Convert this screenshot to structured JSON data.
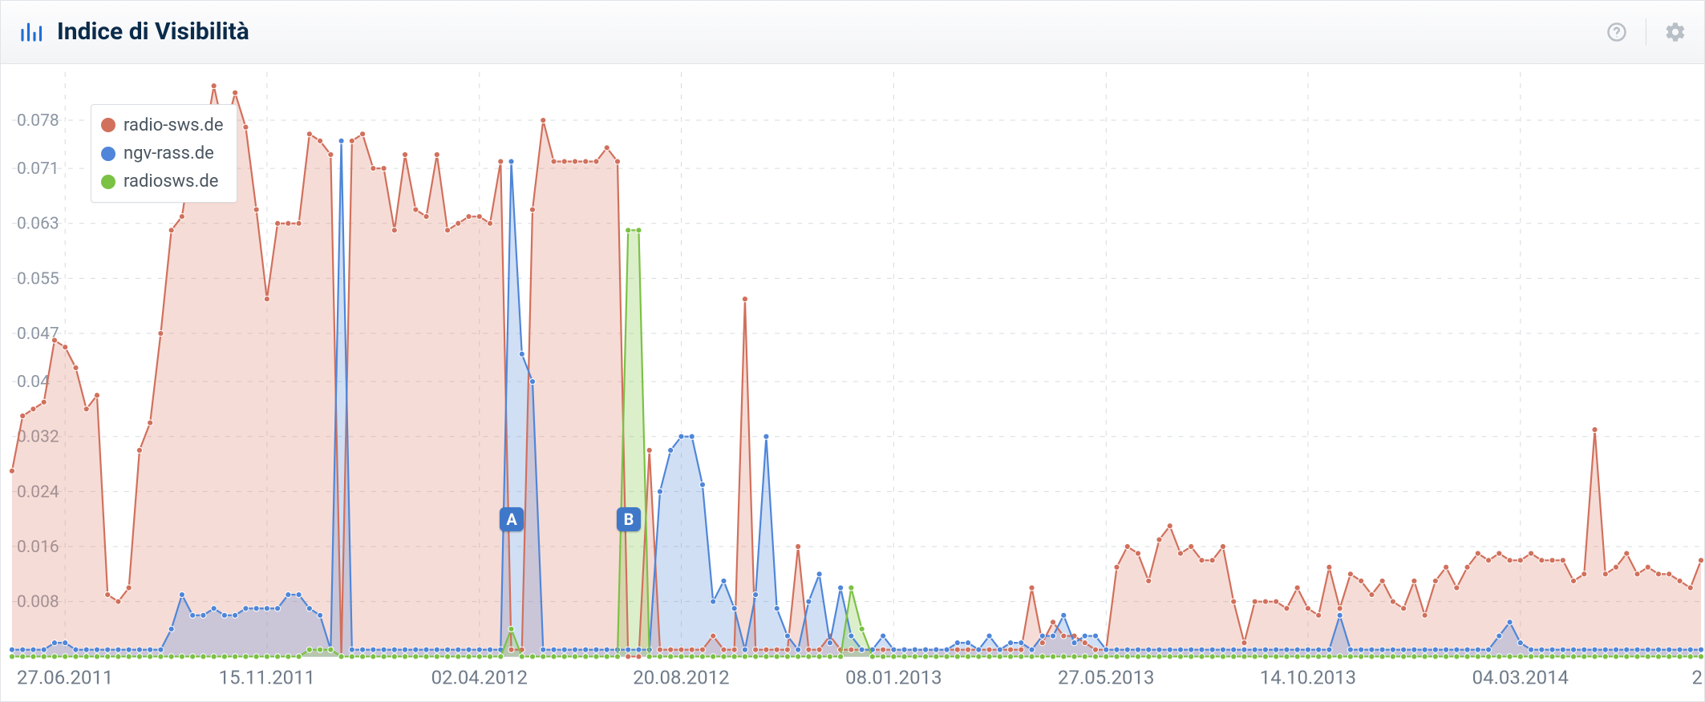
{
  "header": {
    "title": "Indice di Visibilità"
  },
  "legend": [
    {
      "label": "radio-sws.de",
      "color": "#d1705c"
    },
    {
      "label": "ngv-rass.de",
      "color": "#4f86d9"
    },
    {
      "label": "radiosws.de",
      "color": "#7bc144"
    }
  ],
  "annotations": [
    {
      "id": "A",
      "xindex": 47,
      "color": "#3f78c9"
    },
    {
      "id": "B",
      "xindex": 58,
      "color": "#3f78c9"
    }
  ],
  "chart_data": {
    "type": "area",
    "title": "Indice di Visibilità",
    "xlabel": "",
    "ylabel": "",
    "ylim": [
      0,
      0.085
    ],
    "y_ticks": [
      0.008,
      0.016,
      0.024,
      0.032,
      0.04,
      0.047,
      0.055,
      0.063,
      0.071,
      0.078
    ],
    "x_tick_labels": [
      "27.06.2011",
      "15.11.2011",
      "02.04.2012",
      "20.08.2012",
      "08.01.2013",
      "27.05.2013",
      "14.10.2013",
      "04.03.2014"
    ],
    "x_tick_indices": [
      5,
      24,
      44,
      63,
      83,
      103,
      122,
      142
    ],
    "n_points": 160,
    "series": [
      {
        "name": "radio-sws.de",
        "color": "#d1705c",
        "fill": "rgba(221,128,106,0.28)",
        "values": [
          0.027,
          0.035,
          0.036,
          0.037,
          0.046,
          0.045,
          0.042,
          0.036,
          0.038,
          0.009,
          0.008,
          0.01,
          0.03,
          0.034,
          0.047,
          0.062,
          0.064,
          0.074,
          0.074,
          0.083,
          0.076,
          0.082,
          0.077,
          0.065,
          0.052,
          0.063,
          0.063,
          0.063,
          0.076,
          0.075,
          0.073,
          0.0,
          0.075,
          0.076,
          0.071,
          0.071,
          0.062,
          0.073,
          0.065,
          0.064,
          0.073,
          0.062,
          0.063,
          0.064,
          0.064,
          0.063,
          0.072,
          0.001,
          0.001,
          0.065,
          0.078,
          0.072,
          0.072,
          0.072,
          0.072,
          0.072,
          0.074,
          0.072,
          0.0,
          0.0,
          0.03,
          0.001,
          0.001,
          0.001,
          0.001,
          0.001,
          0.003,
          0.001,
          0.001,
          0.052,
          0.001,
          0.001,
          0.001,
          0.001,
          0.016,
          0.001,
          0.001,
          0.003,
          0.001,
          0.001,
          0.001,
          0.001,
          0.001,
          0.001,
          0.001,
          0.001,
          0.001,
          0.001,
          0.001,
          0.001,
          0.001,
          0.001,
          0.001,
          0.001,
          0.001,
          0.001,
          0.01,
          0.002,
          0.005,
          0.003,
          0.003,
          0.002,
          0.001,
          0.001,
          0.013,
          0.016,
          0.015,
          0.011,
          0.017,
          0.019,
          0.015,
          0.016,
          0.014,
          0.014,
          0.016,
          0.008,
          0.002,
          0.008,
          0.008,
          0.008,
          0.007,
          0.01,
          0.007,
          0.006,
          0.013,
          0.007,
          0.012,
          0.011,
          0.009,
          0.011,
          0.008,
          0.007,
          0.011,
          0.006,
          0.011,
          0.013,
          0.01,
          0.013,
          0.015,
          0.014,
          0.015,
          0.014,
          0.014,
          0.015,
          0.014,
          0.014,
          0.014,
          0.011,
          0.012,
          0.033,
          0.012,
          0.013,
          0.015,
          0.012,
          0.013,
          0.012,
          0.012,
          0.011,
          0.01,
          0.014
        ]
      },
      {
        "name": "ngv-rass.de",
        "color": "#4f86d9",
        "fill": "rgba(101,149,219,0.30)",
        "values": [
          0.001,
          0.001,
          0.001,
          0.001,
          0.002,
          0.002,
          0.001,
          0.001,
          0.001,
          0.001,
          0.001,
          0.001,
          0.001,
          0.001,
          0.001,
          0.004,
          0.009,
          0.006,
          0.006,
          0.007,
          0.006,
          0.006,
          0.007,
          0.007,
          0.007,
          0.007,
          0.009,
          0.009,
          0.007,
          0.006,
          0.001,
          0.075,
          0.001,
          0.001,
          0.001,
          0.001,
          0.001,
          0.001,
          0.001,
          0.001,
          0.001,
          0.001,
          0.001,
          0.001,
          0.001,
          0.001,
          0.001,
          0.072,
          0.044,
          0.04,
          0.001,
          0.001,
          0.001,
          0.001,
          0.001,
          0.001,
          0.001,
          0.001,
          0.001,
          0.001,
          0.001,
          0.024,
          0.03,
          0.032,
          0.032,
          0.025,
          0.008,
          0.011,
          0.007,
          0.001,
          0.009,
          0.032,
          0.007,
          0.003,
          0.001,
          0.008,
          0.012,
          0.002,
          0.01,
          0.003,
          0.001,
          0.001,
          0.003,
          0.001,
          0.001,
          0.001,
          0.001,
          0.001,
          0.001,
          0.002,
          0.002,
          0.001,
          0.003,
          0.001,
          0.002,
          0.002,
          0.001,
          0.003,
          0.003,
          0.006,
          0.002,
          0.003,
          0.003,
          0.001,
          0.001,
          0.001,
          0.001,
          0.001,
          0.001,
          0.001,
          0.001,
          0.001,
          0.001,
          0.001,
          0.001,
          0.001,
          0.001,
          0.001,
          0.001,
          0.001,
          0.001,
          0.001,
          0.001,
          0.001,
          0.001,
          0.006,
          0.001,
          0.001,
          0.001,
          0.001,
          0.001,
          0.001,
          0.001,
          0.001,
          0.001,
          0.001,
          0.001,
          0.001,
          0.001,
          0.001,
          0.003,
          0.005,
          0.002,
          0.001,
          0.001,
          0.001,
          0.001,
          0.001,
          0.001,
          0.001,
          0.001,
          0.001,
          0.001,
          0.001,
          0.001,
          0.001,
          0.001,
          0.001,
          0.001,
          0.001
        ]
      },
      {
        "name": "radiosws.de",
        "color": "#7bc144",
        "fill": "rgba(138,203,84,0.30)",
        "values": [
          0.0,
          0.0,
          0.0,
          0.0,
          0.0,
          0.0,
          0.0,
          0.0,
          0.0,
          0.0,
          0.0,
          0.0,
          0.0,
          0.0,
          0.0,
          0.0,
          0.0,
          0.0,
          0.0,
          0.0,
          0.0,
          0.0,
          0.0,
          0.0,
          0.0,
          0.0,
          0.0,
          0.0,
          0.001,
          0.001,
          0.001,
          0.0,
          0.0,
          0.0,
          0.0,
          0.0,
          0.0,
          0.0,
          0.0,
          0.0,
          0.0,
          0.0,
          0.0,
          0.0,
          0.0,
          0.0,
          0.0,
          0.004,
          0.0,
          0.0,
          0.0,
          0.0,
          0.0,
          0.0,
          0.0,
          0.0,
          0.0,
          0.0,
          0.062,
          0.062,
          0.0,
          0.0,
          0.0,
          0.0,
          0.0,
          0.0,
          0.0,
          0.0,
          0.0,
          0.0,
          0.0,
          0.0,
          0.0,
          0.0,
          0.0,
          0.0,
          0.0,
          0.0,
          0.0,
          0.01,
          0.004,
          0.0,
          0.0,
          0.0,
          0.0,
          0.0,
          0.0,
          0.0,
          0.0,
          0.0,
          0.0,
          0.0,
          0.0,
          0.0,
          0.0,
          0.0,
          0.0,
          0.0,
          0.0,
          0.0,
          0.0,
          0.0,
          0.0,
          0.0,
          0.0,
          0.0,
          0.0,
          0.0,
          0.0,
          0.0,
          0.0,
          0.0,
          0.0,
          0.0,
          0.0,
          0.0,
          0.0,
          0.0,
          0.0,
          0.0,
          0.0,
          0.0,
          0.0,
          0.0,
          0.0,
          0.0,
          0.0,
          0.0,
          0.0,
          0.0,
          0.0,
          0.0,
          0.0,
          0.0,
          0.0,
          0.0,
          0.0,
          0.0,
          0.0,
          0.0,
          0.0,
          0.0,
          0.0,
          0.0,
          0.0,
          0.0,
          0.0,
          0.0,
          0.0,
          0.0,
          0.0,
          0.0,
          0.0,
          0.0,
          0.0,
          0.0,
          0.0,
          0.0,
          0.0,
          0.0
        ]
      }
    ]
  }
}
